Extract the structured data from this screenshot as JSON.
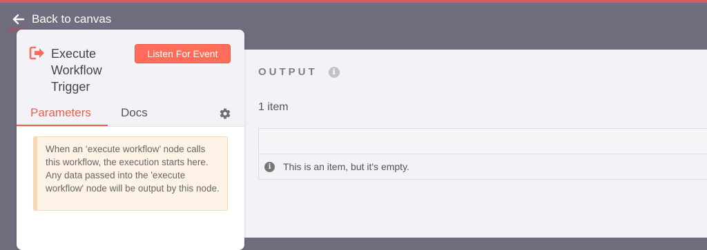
{
  "nav": {
    "back_label": "Back to canvas"
  },
  "node": {
    "title": "Execute Workflow Trigger",
    "listen_button": "Listen For Event",
    "tabs": [
      {
        "label": "Parameters",
        "active": true
      },
      {
        "label": "Docs",
        "active": false
      }
    ],
    "notice": "When an ‘execute workflow’ node calls this workflow, the execution starts here. Any data passed into the 'execute workflow' node will be output by this node."
  },
  "output": {
    "title": "OUTPUT",
    "item_count": "1 item",
    "empty_message": "This is an item, but it's empty."
  },
  "colors": {
    "accent": "#ff6d5a",
    "active_tab": "#e8604d",
    "backdrop": "#6f6d7e",
    "notice_bg": "#fef3e6"
  },
  "icons": {
    "back": "arrow-left-icon",
    "node": "sign-out-icon",
    "settings": "gear-icon",
    "info": "info-circle-icon"
  }
}
